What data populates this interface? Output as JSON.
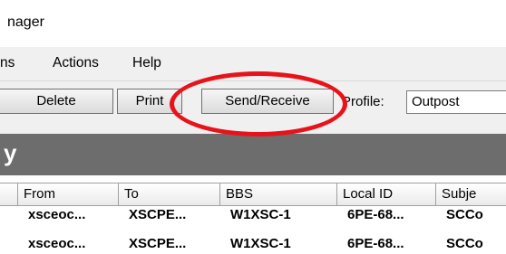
{
  "window": {
    "title": "nager"
  },
  "menu": {
    "items": [
      "ns",
      "Actions",
      "Help"
    ]
  },
  "toolbar": {
    "delete_label": "Delete",
    "print_label": "Print",
    "send_receive_label": "Send/Receive",
    "profile_label": "Profile:",
    "profile_value": "Outpost"
  },
  "folder_bar": {
    "caption": "y"
  },
  "table": {
    "columns": [
      "From",
      "To",
      "BBS",
      "Local ID",
      "Subje"
    ],
    "rows": [
      [
        "xsceoc...",
        "XSCPE...",
        "W1XSC-1",
        "6PE-68...",
        "SCCo"
      ],
      [
        "xsceoc...",
        "XSCPE...",
        "W1XSC-1",
        "6PE-68...",
        "SCCo"
      ]
    ]
  },
  "colors": {
    "annotation": "#e8131a",
    "folder_bar": "#6d6d6d"
  }
}
